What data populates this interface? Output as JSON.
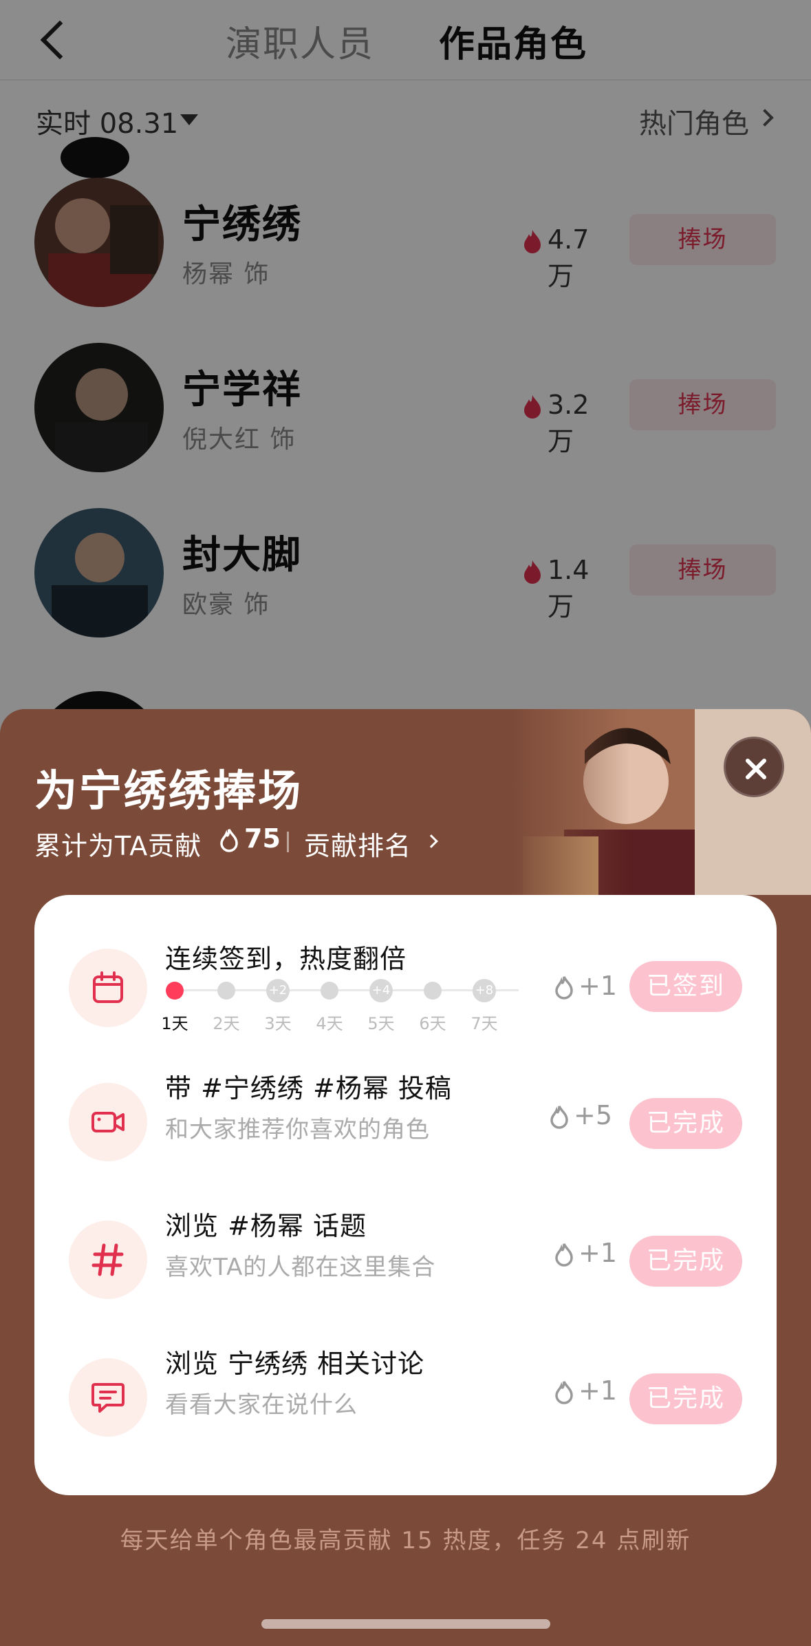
{
  "header": {
    "tabs": [
      {
        "label": "演职人员",
        "active": false
      },
      {
        "label": "作品角色",
        "active": true
      }
    ]
  },
  "filter": {
    "date_label": "实时 08.31",
    "hot_roles_link": "热门角色"
  },
  "roles": [
    {
      "name": "宁绣绣",
      "actor": "杨幂 饰",
      "heat": "4.7万",
      "button": "捧场"
    },
    {
      "name": "宁学祥",
      "actor": "倪大红 饰",
      "heat": "3.2万",
      "button": "捧场"
    },
    {
      "name": "封大脚",
      "actor": "欧豪 饰",
      "heat": "1.4万",
      "button": "捧场"
    }
  ],
  "sheet": {
    "title": "为宁绣绣捧场",
    "contrib_label": "累计为TA贡献",
    "contrib_value": "75",
    "rank_link": "贡献排名",
    "tasks": [
      {
        "title": "连续签到，热度翻倍",
        "subtitle": "",
        "points": "+1",
        "button": "已签到",
        "icon": "calendar-icon"
      },
      {
        "title": "带 #宁绣绣 #杨幂 投稿",
        "subtitle": "和大家推荐你喜欢的角色",
        "points": "+5",
        "button": "已完成",
        "icon": "video-icon"
      },
      {
        "title": "浏览 #杨幂 话题",
        "subtitle": "喜欢TA的人都在这里集合",
        "points": "+1",
        "button": "已完成",
        "icon": "hashtag-icon"
      },
      {
        "title": "浏览 宁绣绣 相关讨论",
        "subtitle": "看看大家在说什么",
        "points": "+1",
        "button": "已完成",
        "icon": "chat-icon"
      }
    ],
    "checkin": {
      "days": [
        "1天",
        "2天",
        "3天",
        "4天",
        "5天",
        "6天",
        "7天"
      ],
      "bonuses": [
        "",
        "",
        "+2",
        "",
        "+4",
        "",
        "+8"
      ],
      "current_day": 1
    },
    "footer_note": "每天给单个角色最高贡献 15 热度，任务 24 点刷新"
  },
  "colors": {
    "accent": "#e0304e",
    "sheet_bg": "#7b4a38",
    "done_button": "#fcc3cf"
  }
}
